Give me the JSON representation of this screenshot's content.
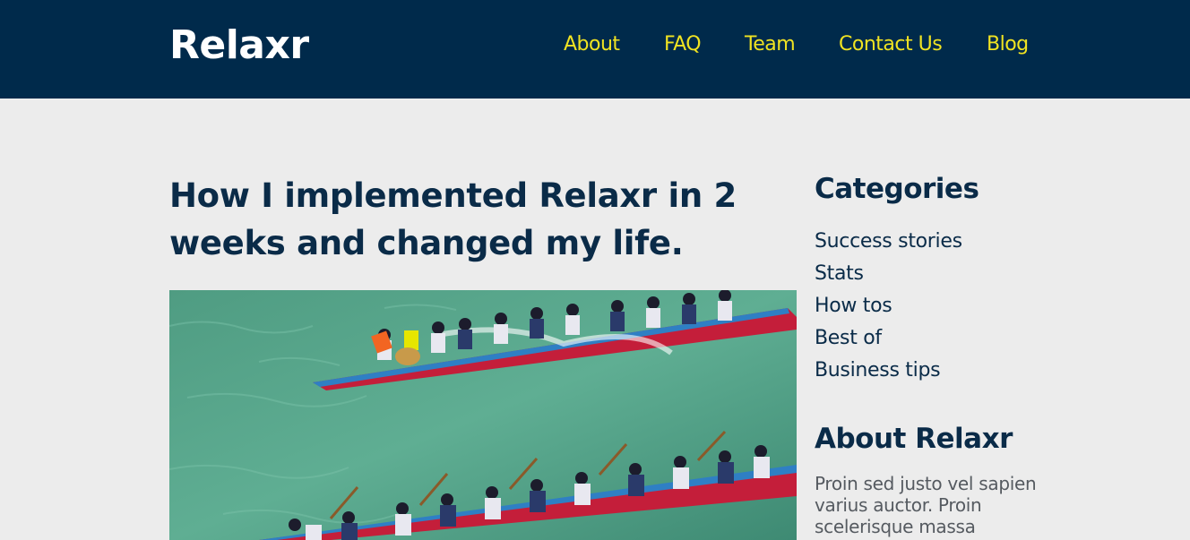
{
  "header": {
    "logo": "Relaxr",
    "nav": [
      "About",
      "FAQ",
      "Team",
      "Contact Us",
      "Blog"
    ],
    "bg_color": "#002a4b",
    "nav_color": "#f0e322"
  },
  "post": {
    "title": "How I implemented Relaxr in 2 weeks and changed my life.",
    "image_subject": "dragon-boat-race-photo"
  },
  "sidebar": {
    "categories_title": "Categories",
    "categories": [
      "Success stories",
      "Stats",
      "How tos",
      "Best of",
      "Business tips"
    ],
    "about_title": "About Relaxr",
    "about_text": "Proin sed justo vel sapien varius auctor. Proin scelerisque massa"
  }
}
